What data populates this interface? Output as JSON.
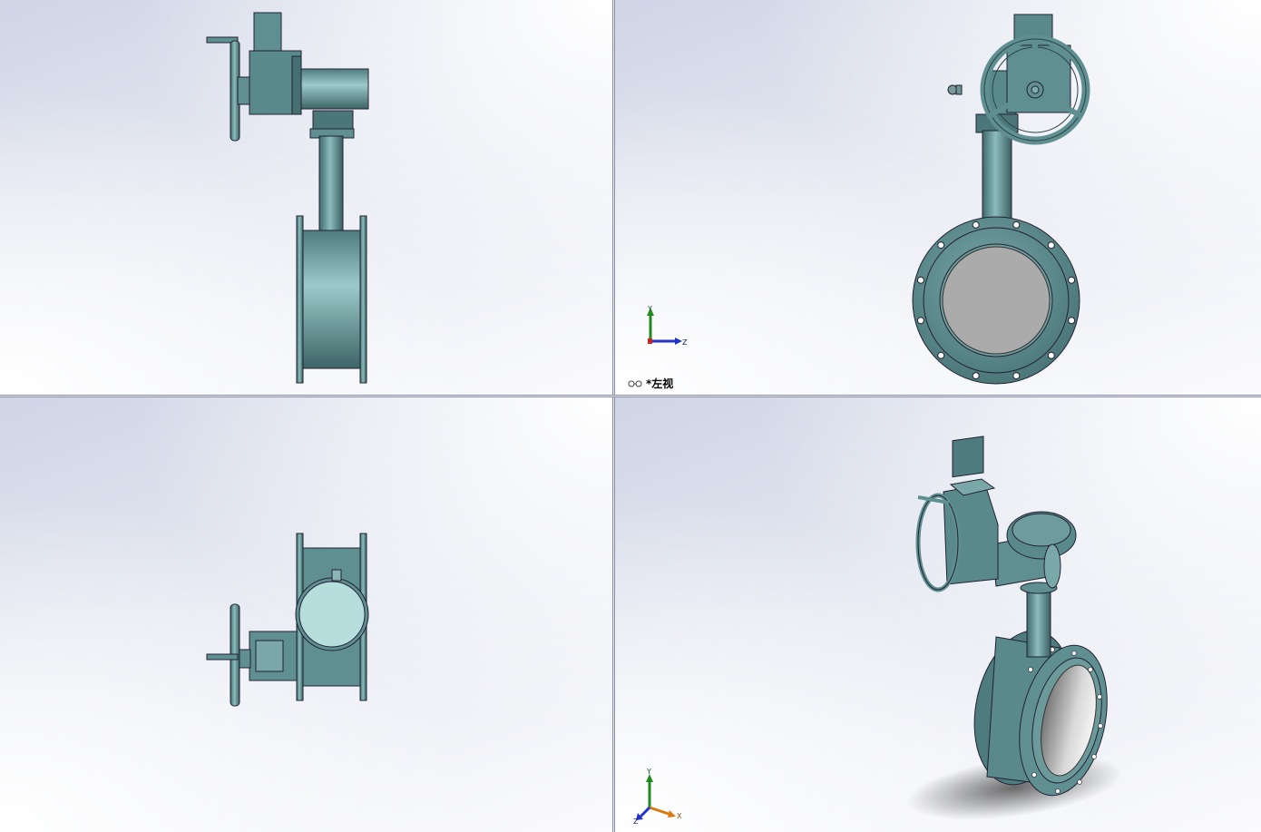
{
  "viewports": {
    "top_left": {
      "name": "front-view"
    },
    "top_right": {
      "name": "left-view",
      "label": "*左视"
    },
    "bottom_left": {
      "name": "top-view"
    },
    "bottom_right": {
      "name": "isometric-view"
    }
  },
  "triad": {
    "y_label": "Y",
    "z_label": "Z",
    "x_label": "X"
  },
  "colors": {
    "body": "#5c8c8e",
    "body_light": "#9fc8c8",
    "body_dark": "#2f4f52",
    "bore": "#a9a9a9",
    "axis_y": "#1f8a1f",
    "axis_z": "#2233cc",
    "axis_x": "#d97a10"
  },
  "icons": [
    "glasses-icon",
    "triad-icon"
  ]
}
